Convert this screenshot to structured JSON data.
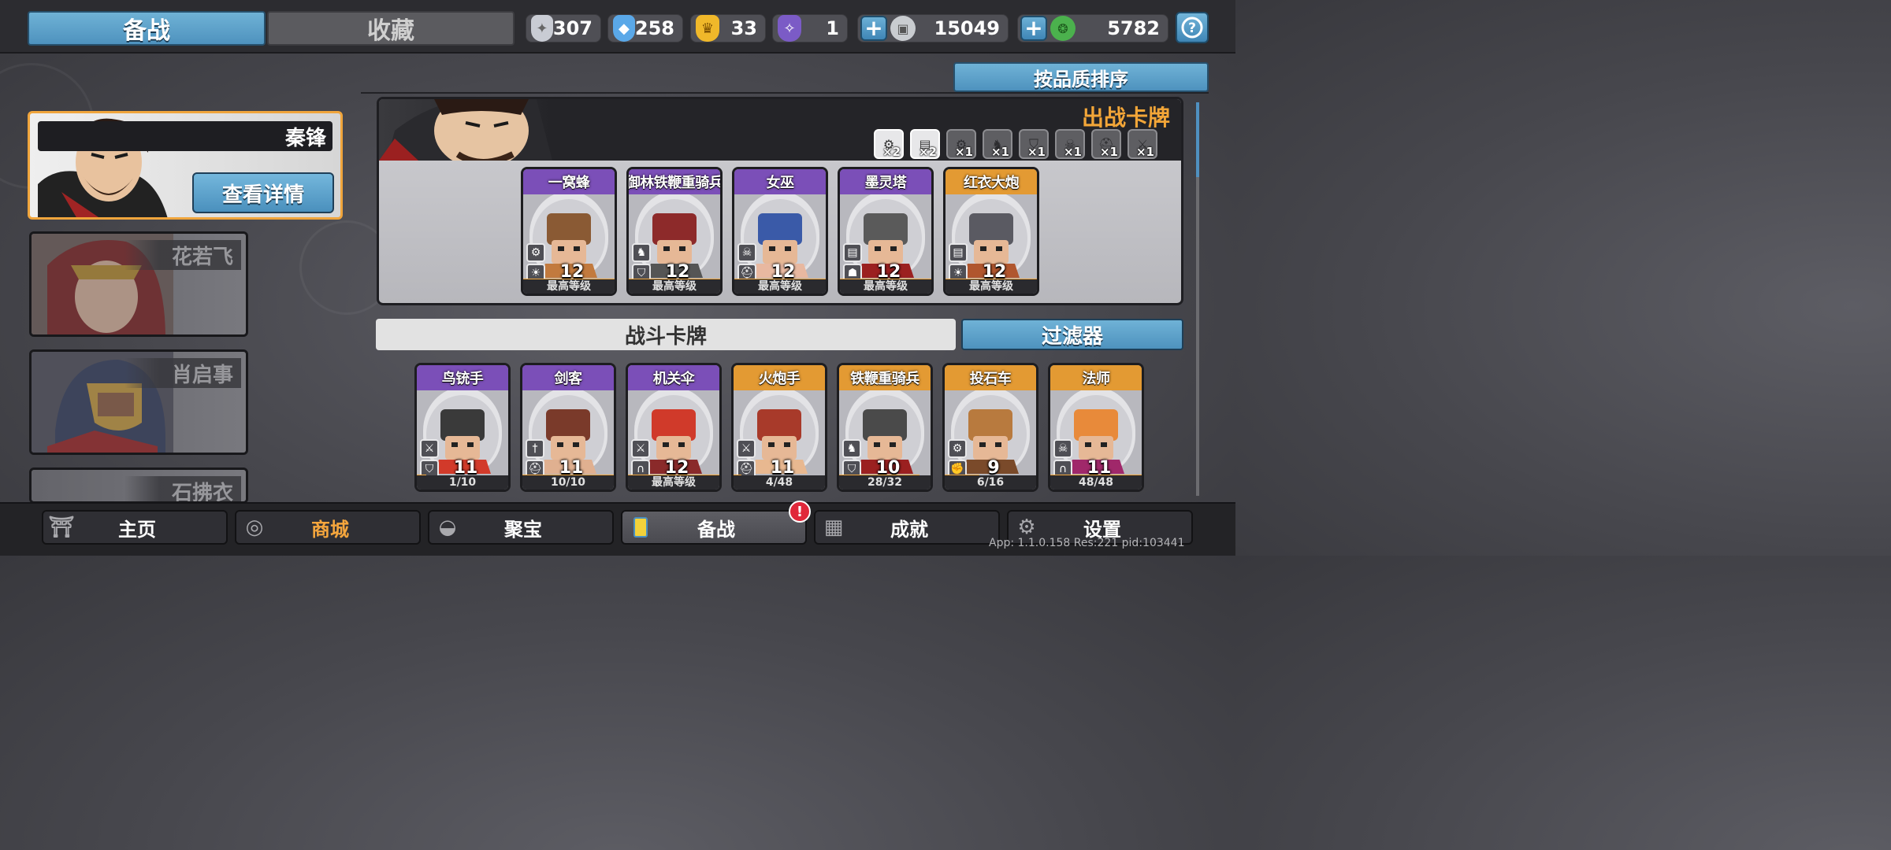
{
  "top_tabs": {
    "prepare": "备战",
    "collection": "收藏"
  },
  "resources": [
    {
      "icon": "silver-gem-icon",
      "value": "307",
      "color": "#c9ccd4"
    },
    {
      "icon": "blue-crystal-icon",
      "value": "258",
      "color": "#5aa8e8"
    },
    {
      "icon": "gold-badge-icon",
      "value": "33",
      "color": "#f0b82a"
    },
    {
      "icon": "purple-badge-icon",
      "value": "1",
      "color": "#7b5bc6"
    }
  ],
  "currency": [
    {
      "icon": "silver-coin-icon",
      "value": "15049",
      "color": "#c9ccd0"
    },
    {
      "icon": "jade-coin-icon",
      "value": "5782",
      "color": "#4bb14d"
    }
  ],
  "heroes": [
    {
      "name": "秦锋",
      "selected": true,
      "details_label": "查看详情"
    },
    {
      "name": "花若飞",
      "selected": false
    },
    {
      "name": "肖启事",
      "selected": false
    },
    {
      "name": "石拂衣",
      "selected": false
    }
  ],
  "sort_label": "按品质排序",
  "deck": {
    "title": "出战卡牌",
    "buffs": [
      {
        "icon": "gear-icon",
        "count": "×2",
        "active": true
      },
      {
        "icon": "wall-icon",
        "count": "×2",
        "active": true
      },
      {
        "icon": "gear-icon",
        "count": "×1",
        "active": false
      },
      {
        "icon": "horse-icon",
        "count": "×1",
        "active": false
      },
      {
        "icon": "shield-icon",
        "count": "×1",
        "active": false
      },
      {
        "icon": "skull-icon",
        "count": "×1",
        "active": false
      },
      {
        "icon": "helmet-icon",
        "count": "×1",
        "active": false
      },
      {
        "icon": "crossed-swords-icon",
        "count": "×1",
        "active": false
      }
    ],
    "cards": [
      {
        "name": "一窝蜂",
        "level": "12",
        "footer": "最高等级",
        "rarity": "purple",
        "icons": [
          "gear-icon",
          "sun-icon"
        ],
        "progress": 1
      },
      {
        "name": "御林铁鞭重骑兵",
        "level": "12",
        "footer": "最高等级",
        "rarity": "purple",
        "icons": [
          "horse-icon",
          "shield-icon"
        ],
        "progress": 1
      },
      {
        "name": "女巫",
        "level": "12",
        "footer": "最高等级",
        "rarity": "purple",
        "icons": [
          "skull-icon",
          "helmet-icon"
        ],
        "progress": 1
      },
      {
        "name": "墨灵塔",
        "level": "12",
        "footer": "最高等级",
        "rarity": "purple",
        "icons": [
          "wall-icon",
          "mask-icon"
        ],
        "progress": 1
      },
      {
        "name": "红衣大炮",
        "level": "12",
        "footer": "最高等级",
        "rarity": "gold",
        "icons": [
          "wall-icon",
          "sun-icon"
        ],
        "progress": 1
      }
    ]
  },
  "battle_section": {
    "title": "战斗卡牌",
    "filter": "过滤器"
  },
  "battle_cards": [
    {
      "name": "鸟铳手",
      "level": "11",
      "footer": "1/10",
      "rarity": "purple",
      "icons": [
        "crossed-swords-icon",
        "shield-icon"
      ],
      "progress": 0.1
    },
    {
      "name": "剑客",
      "level": "11",
      "footer": "10/10",
      "rarity": "purple",
      "icons": [
        "sword-icon",
        "helmet-icon"
      ],
      "progress": 1
    },
    {
      "name": "机关伞",
      "level": "12",
      "footer": "最高等级",
      "rarity": "purple",
      "icons": [
        "crossed-swords-icon",
        "hood-icon"
      ],
      "progress": 1
    },
    {
      "name": "火炮手",
      "level": "11",
      "footer": "4/48",
      "rarity": "gold",
      "icons": [
        "crossed-swords-icon",
        "helmet-icon"
      ],
      "progress": 0.083
    },
    {
      "name": "铁鞭重骑兵",
      "level": "10",
      "footer": "28/32",
      "rarity": "gold",
      "icons": [
        "horse-icon",
        "shield-icon"
      ],
      "progress": 0.875
    },
    {
      "name": "投石车",
      "level": "9",
      "footer": "6/16",
      "rarity": "gold",
      "icons": [
        "gear-icon",
        "fist-icon"
      ],
      "progress": 0.375
    },
    {
      "name": "法师",
      "level": "11",
      "footer": "48/48",
      "rarity": "gold",
      "icons": [
        "skull-icon",
        "hood-icon"
      ],
      "progress": 1
    }
  ],
  "nav": [
    {
      "label": "主页",
      "icon": "pagoda-icon"
    },
    {
      "label": "商城",
      "icon": "coins-icon"
    },
    {
      "label": "聚宝",
      "icon": "treasure-bowl-icon"
    },
    {
      "label": "备战",
      "icon": "cards-icon",
      "alert": "!"
    },
    {
      "label": "成就",
      "icon": "blocks-icon"
    },
    {
      "label": "设置",
      "icon": "gear-icon"
    }
  ],
  "version": "App: 1.1.0.158 Res:221 pid:103441"
}
